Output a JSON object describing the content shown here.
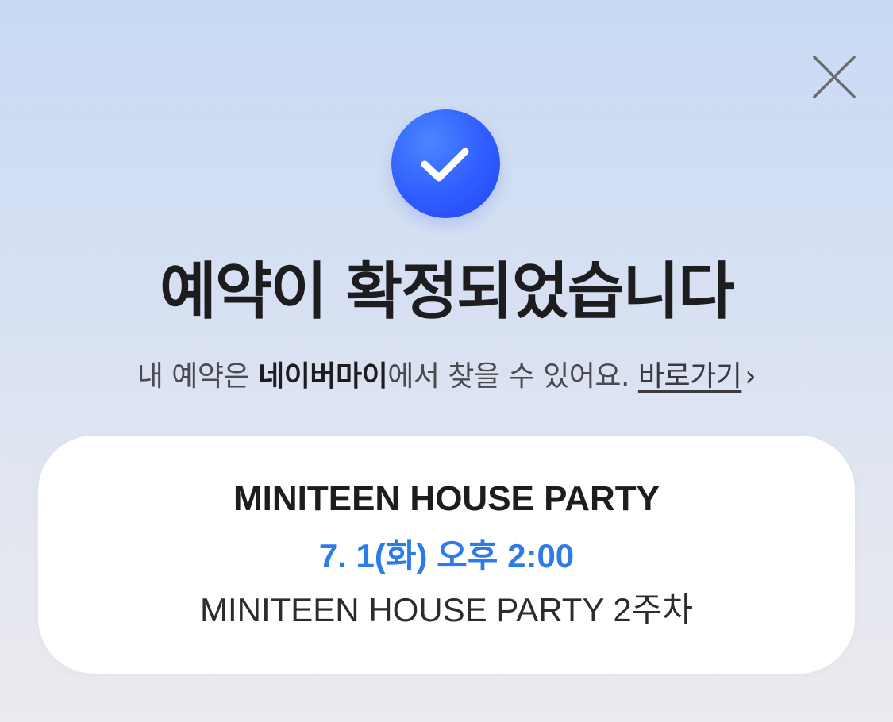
{
  "dialog": {
    "close_icon": "close-icon",
    "status_icon": "check-circle-icon",
    "accent_color": "#2f5cff",
    "title": "예약이 확정되었습니다",
    "subtitle": {
      "prefix": "내 예약은 ",
      "app_name": "네이버마이",
      "suffix": "에서 찾을 수 있어요. ",
      "link_label": "바로가기",
      "link_chevron": "›"
    }
  },
  "booking": {
    "event_name": "MINITEEN HOUSE PARTY",
    "datetime": "7. 1(화) 오후 2:00",
    "detail": "MINITEEN HOUSE PARTY 2주차",
    "datetime_color": "#2b7be8"
  }
}
